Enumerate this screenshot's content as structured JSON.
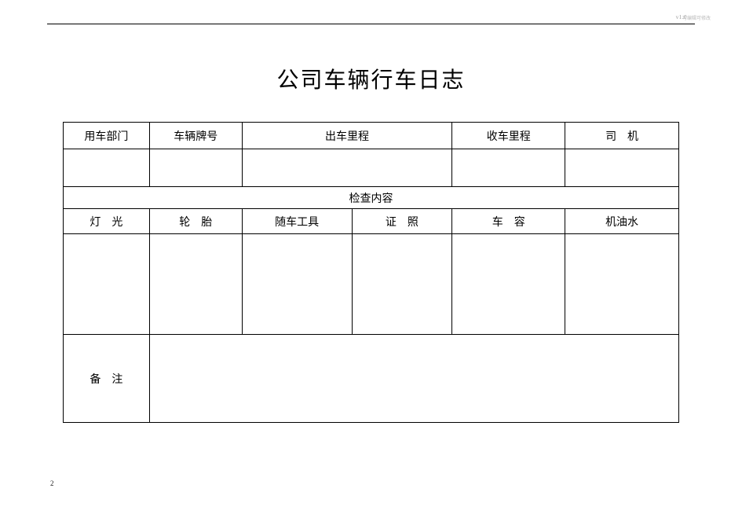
{
  "header": {
    "right_small1": "v1.0",
    "right_small2": "可编辑可修改"
  },
  "title": "公司车辆行车日志",
  "table": {
    "row1": {
      "c1": "用车部门",
      "c2": "车辆牌号",
      "c3": "出车里程",
      "c4": "收车里程",
      "c5": "司　机"
    },
    "row2": {
      "c1": "",
      "c2": "",
      "c3": "",
      "c4": "",
      "c5": ""
    },
    "row3": {
      "span": "检查内容"
    },
    "row4": {
      "c1": "灯　光",
      "c2": "轮　胎",
      "c3": "随车工具",
      "c4": "证　照",
      "c5": "车　容",
      "c6": "机油水"
    },
    "row5": {
      "c1": "",
      "c2": "",
      "c3": "",
      "c4": "",
      "c5": "",
      "c6": ""
    },
    "row6": {
      "label": "备　注",
      "content": ""
    }
  },
  "page_number": "2"
}
